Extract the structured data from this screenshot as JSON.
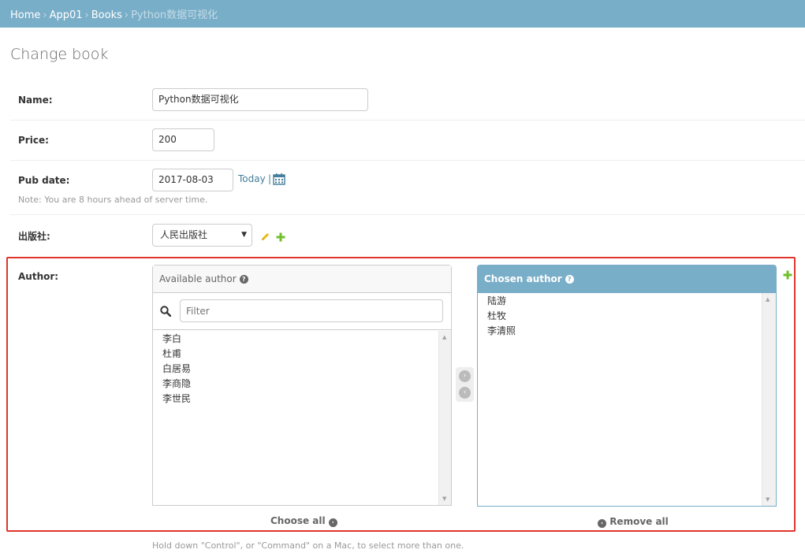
{
  "breadcrumb": {
    "home": "Home",
    "app": "App01",
    "model": "Books",
    "current": "Python数据可视化",
    "separator": "›"
  },
  "title": "Change book",
  "form": {
    "name": {
      "label": "Name:",
      "value": "Python数据可视化"
    },
    "price": {
      "label": "Price:",
      "value": "200"
    },
    "pub_date": {
      "label": "Pub date:",
      "value": "2017-08-03",
      "today_link": "Today",
      "divider": "|",
      "note": "Note: You are 8 hours ahead of server time."
    },
    "publisher": {
      "label": "出版社:",
      "selected": "人民出版社"
    },
    "author": {
      "label": "Author:",
      "available_title": "Available author",
      "filter_placeholder": "Filter",
      "available": [
        "李白",
        "杜甫",
        "白居易",
        "李商隐",
        "李世民"
      ],
      "chosen_title": "Chosen author",
      "chosen": [
        "陆游",
        "杜牧",
        "李清照"
      ],
      "choose_all": "Choose all",
      "remove_all": "Remove all",
      "help_text": "Hold down \"Control\", or \"Command\" on a Mac, to select more than one."
    }
  },
  "colors": {
    "header": "#79aec8",
    "link": "#447e9b",
    "add_green": "#70bf2b",
    "edit_yellow": "#efb80b",
    "highlight_red": "#e0352b"
  },
  "icons": {
    "help": "question-circle",
    "search": "search",
    "calendar": "calendar",
    "edit": "pencil",
    "add": "plus",
    "move_right": "arrow-circle-right",
    "move_left": "arrow-circle-left"
  }
}
